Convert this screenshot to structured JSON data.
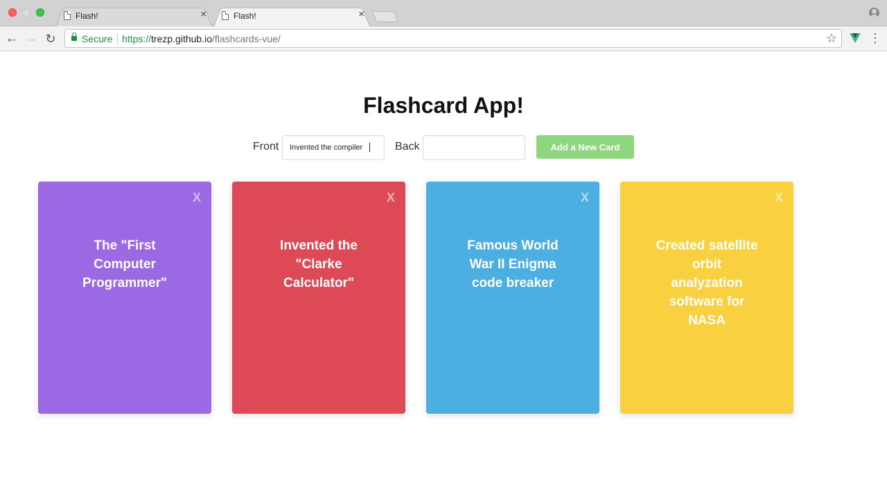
{
  "browser": {
    "tabs": [
      {
        "title": "Flash!",
        "active": false
      },
      {
        "title": "Flash!",
        "active": true
      }
    ],
    "secure_label": "Secure",
    "url": {
      "scheme": "https://",
      "host": "trezp.github.io",
      "path": "/flashcards-vue/"
    }
  },
  "app": {
    "title": "Flashcard App!",
    "front_label": "Front",
    "front_value": "Invented the compiler",
    "back_label": "Back",
    "back_value": "",
    "add_button": "Add a New Card"
  },
  "cards": [
    {
      "text": "The \"First Computer Programmer\"",
      "color": "#9b69e3",
      "close": "X"
    },
    {
      "text": "Invented the \"Clarke Calculator\"",
      "color": "#dd4a55",
      "close": "X"
    },
    {
      "text": "Famous World War II Enigma code breaker",
      "color": "#4daee2",
      "close": "X"
    },
    {
      "text": "Created satellite orbit analyzation software for NASA",
      "color": "#f9d03f",
      "close": "X"
    }
  ]
}
